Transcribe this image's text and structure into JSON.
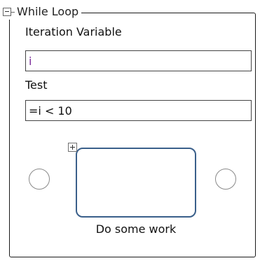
{
  "while_loop": {
    "title": "While Loop",
    "iteration_variable": {
      "label": "Iteration Variable",
      "value": "i"
    },
    "test": {
      "label": "Test",
      "value": "=i < 10"
    },
    "body_activity": {
      "label": "Do some work"
    }
  },
  "icons": {
    "collapse": "minus-box-icon",
    "expand": "plus-box-icon"
  },
  "colors": {
    "activity_border": "#3a5f8a",
    "variable_text": "#7a2a9a"
  }
}
